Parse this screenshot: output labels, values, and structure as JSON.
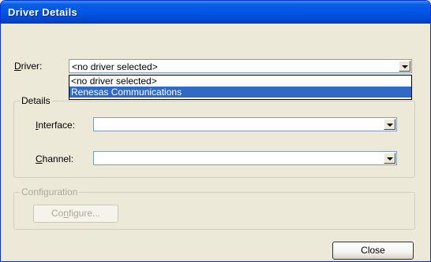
{
  "window": {
    "title": "Driver Details"
  },
  "driver": {
    "label_pre": "",
    "label_ul": "D",
    "label_post": "river:",
    "selected": "<no driver selected>",
    "options": [
      "<no driver selected>",
      "Renesas Communications"
    ]
  },
  "details": {
    "legend": "Details",
    "interface_label_ul": "I",
    "interface_label_post": "nterface:",
    "interface_value": "",
    "channel_label_ul": "C",
    "channel_label_post": "hannel:",
    "channel_value": ""
  },
  "configuration": {
    "legend": "Configuration",
    "button_pre": "Co",
    "button_ul": "n",
    "button_post": "figure..."
  },
  "close_button": "Close"
}
